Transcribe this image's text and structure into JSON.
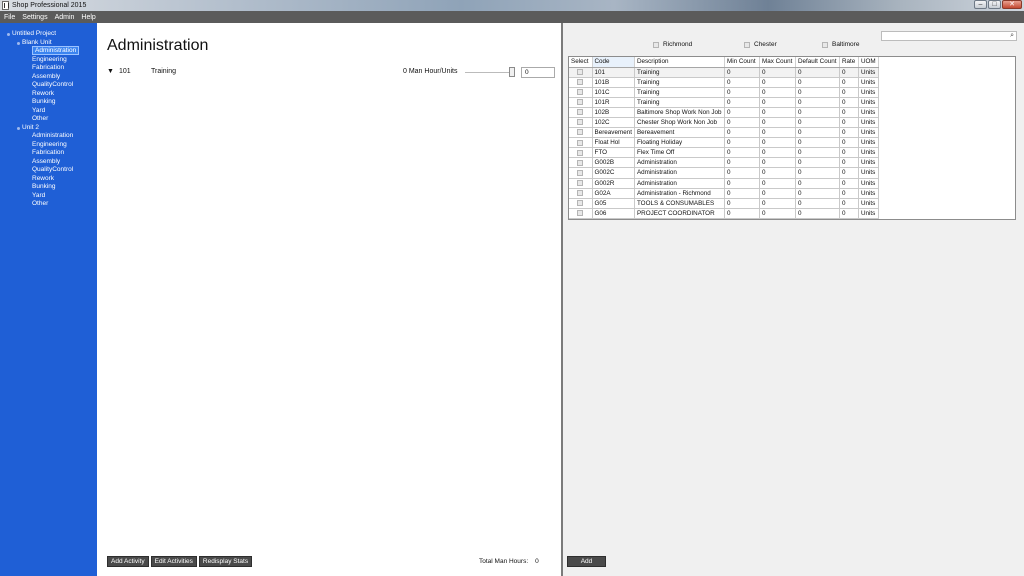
{
  "window": {
    "title": "Shop Professional 2015",
    "minimize": "–",
    "maximize": "□",
    "close": "✕"
  },
  "menu": [
    "File",
    "Settings",
    "Admin",
    "Help"
  ],
  "tree": [
    {
      "label": "Untitled Project",
      "level": 0,
      "selected": false
    },
    {
      "label": "Blank Unit",
      "level": 1,
      "selected": false
    },
    {
      "label": "Administration",
      "level": 2,
      "selected": true
    },
    {
      "label": "Engineering",
      "level": 2,
      "selected": false
    },
    {
      "label": "Fabrication",
      "level": 2,
      "selected": false
    },
    {
      "label": "Assembly",
      "level": 2,
      "selected": false
    },
    {
      "label": "QualityControl",
      "level": 2,
      "selected": false
    },
    {
      "label": "Rework",
      "level": 2,
      "selected": false
    },
    {
      "label": "Bunking",
      "level": 2,
      "selected": false
    },
    {
      "label": "Yard",
      "level": 2,
      "selected": false
    },
    {
      "label": "Other",
      "level": 2,
      "selected": false
    },
    {
      "label": "Unit 2",
      "level": 1,
      "selected": false
    },
    {
      "label": "Administration",
      "level": 2,
      "selected": false
    },
    {
      "label": "Engineering",
      "level": 2,
      "selected": false
    },
    {
      "label": "Fabrication",
      "level": 2,
      "selected": false
    },
    {
      "label": "Assembly",
      "level": 2,
      "selected": false
    },
    {
      "label": "QualityControl",
      "level": 2,
      "selected": false
    },
    {
      "label": "Rework",
      "level": 2,
      "selected": false
    },
    {
      "label": "Bunking",
      "level": 2,
      "selected": false
    },
    {
      "label": "Yard",
      "level": 2,
      "selected": false
    },
    {
      "label": "Other",
      "level": 2,
      "selected": false
    }
  ],
  "main": {
    "title": "Administration",
    "activity": {
      "toggle": "▼",
      "code": "101",
      "description": "Training",
      "man_hours_label": "0 Man Hour/Units",
      "value": "0"
    },
    "buttons": {
      "add": "Add Activity",
      "edit": "Edit Activities",
      "redisplay": "Redisplay Stats"
    },
    "total_label": "Total Man Hours:",
    "total_value": "0"
  },
  "right": {
    "locations": [
      "Richmond",
      "Chester",
      "Baltimore"
    ],
    "search_placeholder": "",
    "search_icon": "search-icon",
    "columns": [
      "Select",
      "Code",
      "Description",
      "Min Count",
      "Max Count",
      "Default Count",
      "Rate",
      "UOM"
    ],
    "rows": [
      [
        "101",
        "Training",
        "0",
        "0",
        "0",
        "0",
        "Units"
      ],
      [
        "101B",
        "Training",
        "0",
        "0",
        "0",
        "0",
        "Units"
      ],
      [
        "101C",
        "Training",
        "0",
        "0",
        "0",
        "0",
        "Units"
      ],
      [
        "101R",
        "Training",
        "0",
        "0",
        "0",
        "0",
        "Units"
      ],
      [
        "102B",
        "Baltimore Shop Work Non Job",
        "0",
        "0",
        "0",
        "0",
        "Units"
      ],
      [
        "102C",
        "Chester  Shop Work Non Job",
        "0",
        "0",
        "0",
        "0",
        "Units"
      ],
      [
        "Bereavement",
        "Bereavement",
        "0",
        "0",
        "0",
        "0",
        "Units"
      ],
      [
        "Float Hol",
        "Floating Holiday",
        "0",
        "0",
        "0",
        "0",
        "Units"
      ],
      [
        "FTO",
        "Flex Time Off",
        "0",
        "0",
        "0",
        "0",
        "Units"
      ],
      [
        "G002B",
        "Administration",
        "0",
        "0",
        "0",
        "0",
        "Units"
      ],
      [
        "G002C",
        "Administration",
        "0",
        "0",
        "0",
        "0",
        "Units"
      ],
      [
        "G002R",
        "Administration",
        "0",
        "0",
        "0",
        "0",
        "Units"
      ],
      [
        "G02A",
        "Administration - Richmond",
        "0",
        "0",
        "0",
        "0",
        "Units"
      ],
      [
        "G05",
        "TOOLS & CONSUMABLES",
        "0",
        "0",
        "0",
        "0",
        "Units"
      ],
      [
        "G06",
        "PROJECT COORDINATOR",
        "0",
        "0",
        "0",
        "0",
        "Units"
      ]
    ],
    "add_button": "Add"
  }
}
